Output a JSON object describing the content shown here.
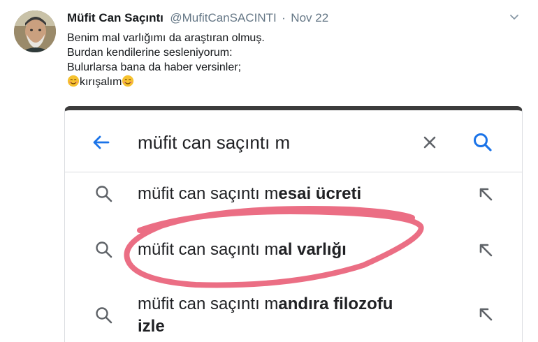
{
  "tweet": {
    "author_name": "Müfit Can Saçıntı",
    "author_handle": "@MufitCanSACINTI",
    "separator": "·",
    "date": "Nov 22",
    "lines": [
      "Benim mal varlığımı da araştıran olmuş.",
      "Burdan kendilerine sesleniyorum:",
      "Bulurlarsa bana da haber versinler;"
    ],
    "last_line_text": "kırışalım",
    "emoji_name": "smiling-face-with-smiling-eyes"
  },
  "search": {
    "query": "müfit can saçıntı m",
    "accent_color": "#1a73e8",
    "suggestions": [
      {
        "prefix": "müfit can saçıntı m",
        "bold": "esai ücreti",
        "line2": ""
      },
      {
        "prefix": "müfit can saçıntı m",
        "bold": "al varlığı",
        "line2": ""
      },
      {
        "prefix": "müfit can saçıntı m",
        "bold": "andıra filozofu",
        "line2": "izle"
      }
    ]
  },
  "annotation": {
    "ring_color": "#e8556f"
  }
}
